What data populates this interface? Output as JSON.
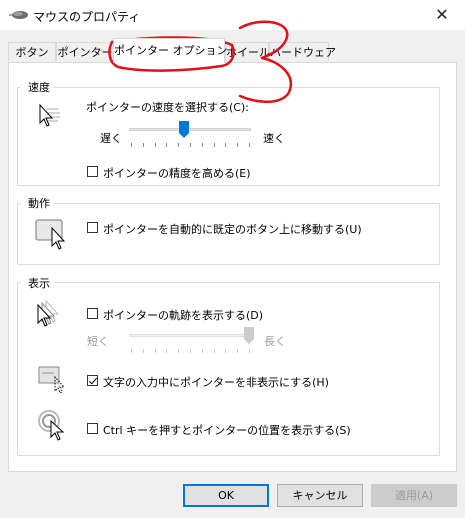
{
  "window": {
    "title": "マウスのプロパティ",
    "close_glyph": "✕"
  },
  "tabs": [
    {
      "label": "ボタン"
    },
    {
      "label": "ポインター"
    },
    {
      "label": "ポインター オプション",
      "active": true
    },
    {
      "label": "ホイール"
    },
    {
      "label": "ハードウェア"
    }
  ],
  "motion": {
    "group_label": "速度",
    "speed_label": "ポインターの速度を選択する(C):",
    "slow_label": "遅く",
    "fast_label": "速く",
    "speed_value_fraction": 0.45,
    "precision_label": "ポインターの精度を高める(E)",
    "precision_checked": false,
    "icon": "pointer-speed-icon"
  },
  "snap": {
    "group_label": "動作",
    "snap_label": "ポインターを自動的に既定のボタン上に移動する(U)",
    "snap_checked": false,
    "icon": "snap-to-button-icon"
  },
  "visibility": {
    "group_label": "表示",
    "trails_label": "ポインターの軌跡を表示する(D)",
    "trails_checked": false,
    "short_label": "短く",
    "long_label": "長く",
    "trails_value_fraction": 1.0,
    "hide_label": "文字の入力中にポインターを非表示にする(H)",
    "hide_checked": true,
    "ctrl_label": "Ctrl キーを押すとポインターの位置を表示する(S)",
    "ctrl_checked": false,
    "icons": [
      "pointer-trails-icon",
      "hide-while-typing-icon",
      "ctrl-locate-icon"
    ]
  },
  "buttons": {
    "ok": "OK",
    "cancel": "キャンセル",
    "apply": "適用(A)"
  },
  "colors": {
    "accent": "#0078d7",
    "annotation": "#e0101b"
  }
}
